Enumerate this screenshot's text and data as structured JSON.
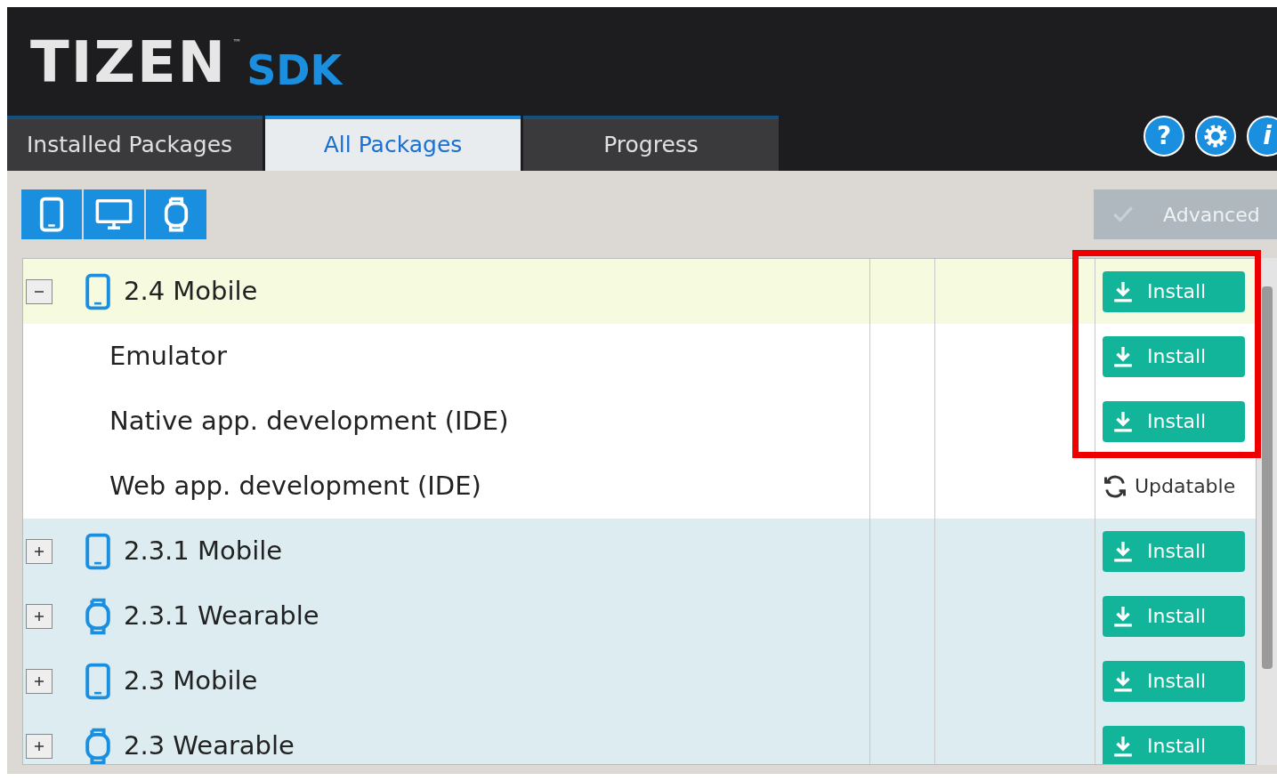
{
  "logo": {
    "brand": "TIZEN",
    "tm": "™",
    "product": "SDK"
  },
  "tabs": [
    {
      "label": "Installed Packages",
      "selected": false
    },
    {
      "label": "All Packages",
      "selected": true
    },
    {
      "label": "Progress",
      "selected": false
    }
  ],
  "header_icons": {
    "help": "?",
    "info": "i"
  },
  "device_filters": [
    {
      "kind": "mobile",
      "selected": true
    },
    {
      "kind": "tv",
      "selected": true
    },
    {
      "kind": "wearable",
      "selected": true
    }
  ],
  "advanced": {
    "label": "Advanced",
    "checked": false,
    "disabled": true
  },
  "rows": [
    {
      "kind": "mobile",
      "name": "2.4 Mobile",
      "expanded": true,
      "action": {
        "kind": "install",
        "label": "Install"
      },
      "children": [
        {
          "name": "Emulator",
          "action": {
            "kind": "install",
            "label": "Install"
          }
        },
        {
          "name": "Native app. development (IDE)",
          "action": {
            "kind": "install",
            "label": "Install"
          }
        },
        {
          "name": "Web app. development (IDE)",
          "action": {
            "kind": "updatable",
            "label": "Updatable"
          }
        }
      ]
    },
    {
      "kind": "mobile",
      "name": "2.3.1 Mobile",
      "expanded": false,
      "action": {
        "kind": "install",
        "label": "Install"
      }
    },
    {
      "kind": "wearable",
      "name": "2.3.1 Wearable",
      "expanded": false,
      "action": {
        "kind": "install",
        "label": "Install"
      }
    },
    {
      "kind": "mobile",
      "name": "2.3 Mobile",
      "expanded": false,
      "action": {
        "kind": "install",
        "label": "Install"
      }
    },
    {
      "kind": "wearable",
      "name": "2.3 Wearable",
      "expanded": false,
      "action": {
        "kind": "install",
        "label": "Install"
      }
    }
  ]
}
